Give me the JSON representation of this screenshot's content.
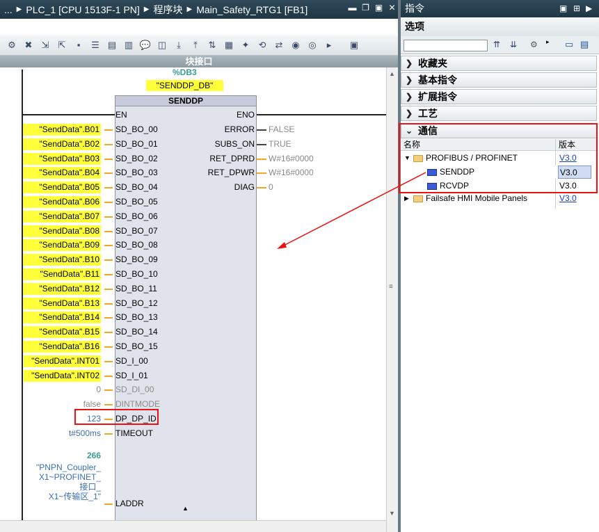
{
  "editor": {
    "breadcrumb": [
      "...",
      "PLC_1 [CPU 1513F-1 PN]",
      "程序块",
      "Main_Safety_RTG1 [FB1]"
    ],
    "collapse_label": "块接口"
  },
  "block": {
    "db_address": "%DB3",
    "db_name": "\"SENDDP_DB\"",
    "name": "SENDDP",
    "en": "EN",
    "eno": "ENO",
    "inputs": [
      {
        "pin": "SD_BO_00",
        "arg": "\"SendData\".B01"
      },
      {
        "pin": "SD_BO_01",
        "arg": "\"SendData\".B02"
      },
      {
        "pin": "SD_BO_02",
        "arg": "\"SendData\".B03"
      },
      {
        "pin": "SD_BO_03",
        "arg": "\"SendData\".B04"
      },
      {
        "pin": "SD_BO_04",
        "arg": "\"SendData\".B05"
      },
      {
        "pin": "SD_BO_05",
        "arg": "\"SendData\".B06"
      },
      {
        "pin": "SD_BO_06",
        "arg": "\"SendData\".B07"
      },
      {
        "pin": "SD_BO_07",
        "arg": "\"SendData\".B08"
      },
      {
        "pin": "SD_BO_08",
        "arg": "\"SendData\".B09"
      },
      {
        "pin": "SD_BO_09",
        "arg": "\"SendData\".B10"
      },
      {
        "pin": "SD_BO_10",
        "arg": "\"SendData\".B11"
      },
      {
        "pin": "SD_BO_11",
        "arg": "\"SendData\".B12"
      },
      {
        "pin": "SD_BO_12",
        "arg": "\"SendData\".B13"
      },
      {
        "pin": "SD_BO_13",
        "arg": "\"SendData\".B14"
      },
      {
        "pin": "SD_BO_14",
        "arg": "\"SendData\".B15"
      },
      {
        "pin": "SD_BO_15",
        "arg": "\"SendData\".B16"
      },
      {
        "pin": "SD_I_00",
        "arg": "\"SendData\".INT01"
      },
      {
        "pin": "SD_I_01",
        "arg": "\"SendData\".INT02"
      },
      {
        "pin": "SD_DI_00",
        "arg": "0"
      },
      {
        "pin": "DINTMODE",
        "arg": "false"
      },
      {
        "pin": "DP_DP_ID",
        "arg": "123"
      },
      {
        "pin": "TIMEOUT",
        "arg": "t#500ms"
      },
      {
        "pin": "LADDR",
        "arg": ""
      }
    ],
    "outputs": [
      {
        "pin": "ERROR",
        "arg": "FALSE"
      },
      {
        "pin": "SUBS_ON",
        "arg": "TRUE"
      },
      {
        "pin": "RET_DPRD",
        "arg": "W#16#0000"
      },
      {
        "pin": "RET_DPWR",
        "arg": "W#16#0000"
      },
      {
        "pin": "DIAG",
        "arg": "0"
      }
    ],
    "laddr_value": "266",
    "laddr_lines": [
      "\"PNPN_Coupler_",
      "X1~PROFINET_",
      "接口_",
      "X1~传输区_1\""
    ]
  },
  "instructions": {
    "title": "指令",
    "options_label": "选项",
    "sections": [
      "收藏夹",
      "基本指令",
      "扩展指令",
      "工艺",
      "通信"
    ],
    "col_name": "名称",
    "col_version": "版本",
    "rows": [
      {
        "name": "PROFIBUS / PROFINET",
        "version": "V3.0"
      },
      {
        "name": "SENDDP",
        "version": "V3.0"
      },
      {
        "name": "RCVDP",
        "version": "V3.0"
      },
      {
        "name": "Failsafe HMI Mobile Panels",
        "version": "V3.0"
      }
    ]
  },
  "colors": {
    "accent_red": "#e11111",
    "highlight_yellow": "#ffff3a",
    "link_blue": "#1a3fbf"
  }
}
